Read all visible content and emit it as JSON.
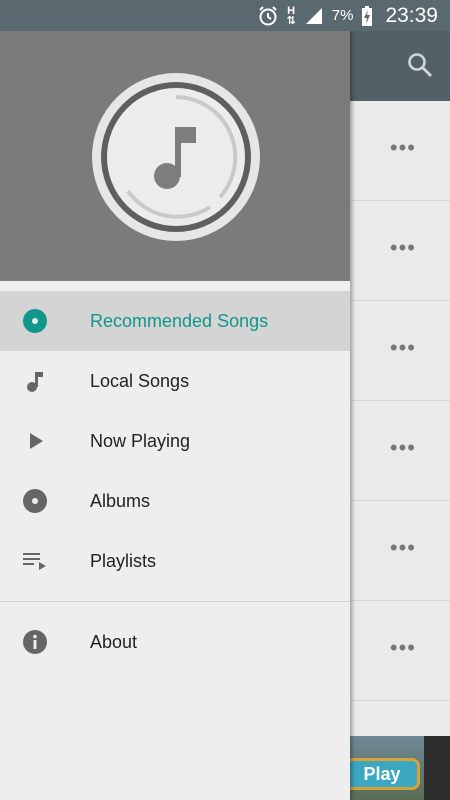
{
  "status_bar": {
    "battery_percent": "7%",
    "time": "23:39",
    "network_label": "H"
  },
  "drawer": {
    "menu": [
      {
        "label": "Recommended Songs",
        "icon": "disc-icon",
        "active": true
      },
      {
        "label": "Local Songs",
        "icon": "music-note-icon",
        "active": false
      },
      {
        "label": "Now Playing",
        "icon": "play-icon",
        "active": false
      },
      {
        "label": "Albums",
        "icon": "album-icon",
        "active": false
      },
      {
        "label": "Playlists",
        "icon": "playlist-icon",
        "active": false
      }
    ],
    "secondary": [
      {
        "label": "About",
        "icon": "info-icon"
      }
    ]
  },
  "background": {
    "ad_text": "Play"
  },
  "colors": {
    "accent": "#11968b",
    "toolbar": "#546068",
    "drawer_header": "#7b7b7b"
  }
}
